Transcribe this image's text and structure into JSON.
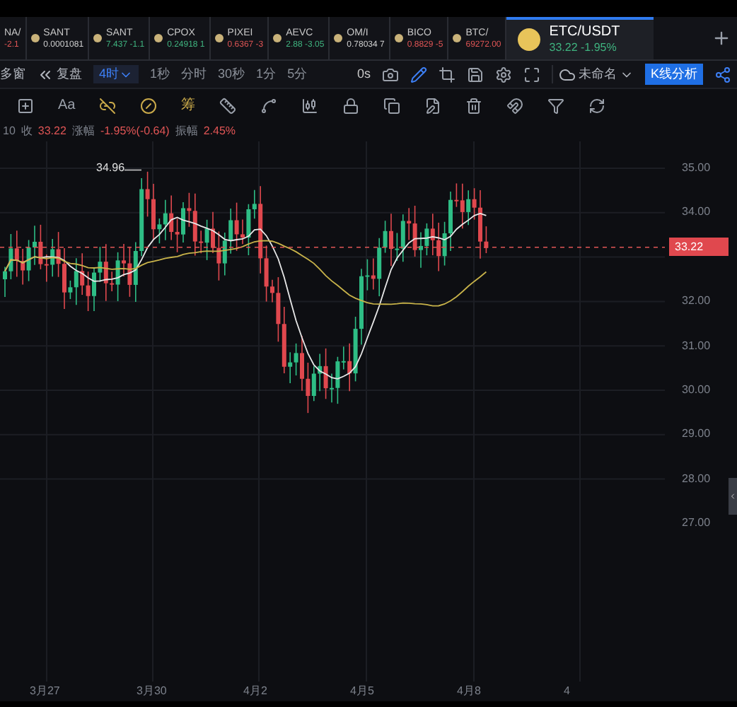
{
  "tickers": [
    {
      "name": "NA/",
      "quote": "-2.1",
      "color": "#e05555",
      "selected": false,
      "coin_icon": false
    },
    {
      "name": "SANT",
      "quote": "0.0001081",
      "color": "#d0d0d0",
      "selected": false
    },
    {
      "name": "SANT",
      "quote": "7.437 -1.1",
      "color": "#3fb37f",
      "selected": false
    },
    {
      "name": "CPOX",
      "quote": "0.24918 1",
      "color": "#3fb37f",
      "selected": false
    },
    {
      "name": "PIXEI",
      "quote": "0.6367 -3",
      "color": "#e05555",
      "selected": false
    },
    {
      "name": "AEVC",
      "quote": "2.88 -3.05",
      "color": "#3fb37f",
      "selected": false
    },
    {
      "name": "OM/I",
      "quote": "0.78034 7",
      "color": "#d0d0d0",
      "selected": false
    },
    {
      "name": "BICO",
      "quote": "0.8829 -5",
      "color": "#e05555",
      "selected": false
    },
    {
      "name": "BTC/",
      "quote": "69272.00",
      "color": "#e05555",
      "selected": false
    },
    {
      "name": "ETC/USDT",
      "quote": "33.22 -1.95%",
      "color": "#3fb37f",
      "selected": true
    }
  ],
  "toolbar": {
    "multi_window": "多窗",
    "replay": "复盘",
    "intervals": [
      {
        "label": "4时",
        "selected": true
      },
      {
        "label": "1秒",
        "selected": false
      },
      {
        "label": "分时",
        "selected": false
      },
      {
        "label": "30秒",
        "selected": false
      },
      {
        "label": "1分",
        "selected": false
      },
      {
        "label": "5分",
        "selected": false
      }
    ],
    "countdown": "0s",
    "layout_name": "未命名",
    "analysis_button": "K线分析"
  },
  "drawing_tools": {
    "text": "Aa",
    "chips": "筹"
  },
  "info_line": [
    {
      "text": "10",
      "kind": "label"
    },
    {
      "text": "收",
      "kind": "label"
    },
    {
      "text": "33.22",
      "kind": "value"
    },
    {
      "text": "涨幅",
      "kind": "label"
    },
    {
      "text": "-1.95%(-0.64)",
      "kind": "value"
    },
    {
      "text": "振幅",
      "kind": "label"
    },
    {
      "text": "2.45%",
      "kind": "value"
    }
  ],
  "chart": {
    "high_marker": "34.96",
    "last_price": "33.22",
    "price_scale": [
      "35.00",
      "34.00",
      "32.00",
      "31.00",
      "30.00",
      "29.00",
      "28.00",
      "27.00"
    ],
    "dates": [
      "3月27",
      "3月30",
      "4月2",
      "4月5",
      "4月8",
      "4"
    ]
  }
}
